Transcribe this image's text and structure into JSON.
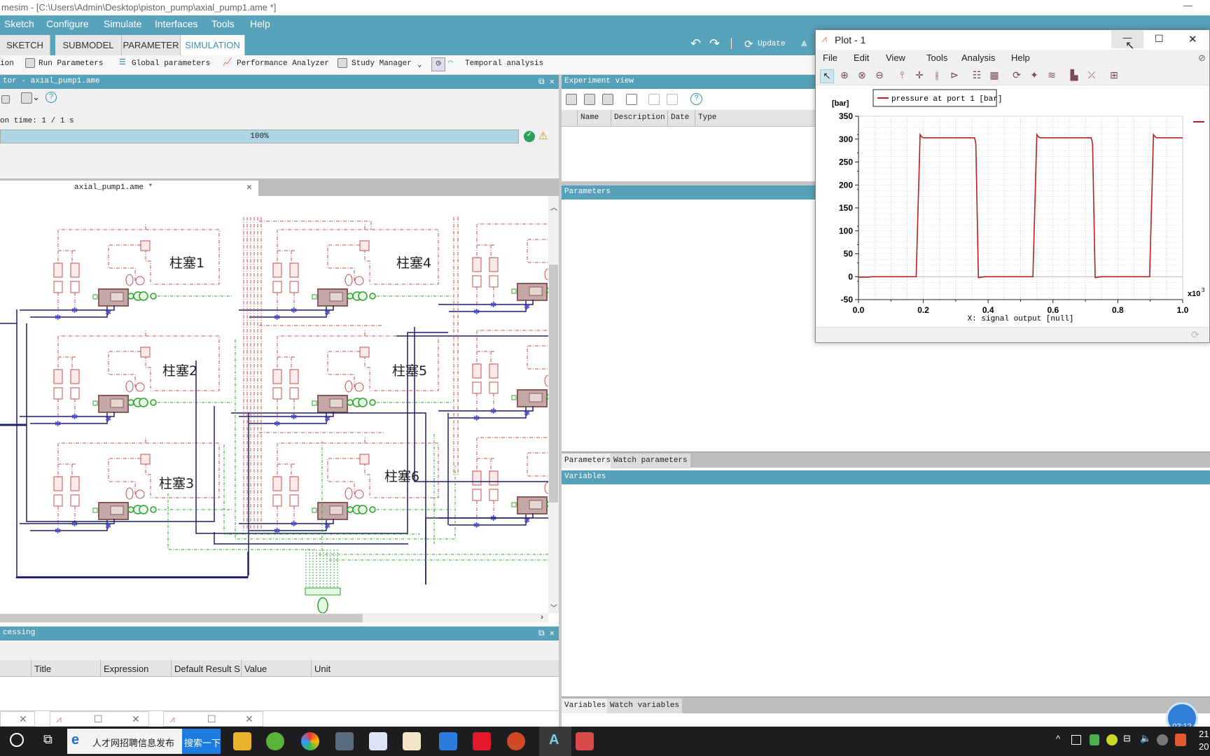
{
  "window": {
    "title": "mesim - [C:\\Users\\Admin\\Desktop\\piston_pump\\axial_pump1.ame *]",
    "minimize": "—"
  },
  "menu": [
    "Sketch",
    "Configure",
    "Simulate",
    "Interfaces",
    "Tools",
    "Help"
  ],
  "ribbon_tabs": [
    {
      "label": "SKETCH"
    },
    {
      "label": "SUBMODEL"
    },
    {
      "label": "PARAMETER"
    },
    {
      "label": "SIMULATION",
      "active": true
    }
  ],
  "ribbon_right": {
    "undo": "↶",
    "redo": "↷",
    "update": "Update"
  },
  "toolbar": {
    "run": "ion",
    "run_parameters": "Run Parameters",
    "global_parameters": "Global parameters",
    "performance_analyzer": "Performance Analyzer",
    "study_manager": "Study Manager",
    "temporal_analysis": "Temporal analysis"
  },
  "monitor": {
    "title": "tor - axial_pump1.ame",
    "time_text": "on time: 1 / 1 s",
    "progress_percent": 100,
    "progress_label": "100%",
    "status_color": "#2e9e5b"
  },
  "sketch": {
    "tab": "axial_pump1.ame *",
    "labels": [
      "柱塞1",
      "柱塞2",
      "柱塞3",
      "柱塞4",
      "柱塞5",
      "柱塞6"
    ],
    "colors": {
      "signal": "#c0504d",
      "hydraulic": "#1f1f6e",
      "mechanical": "#2ca02c"
    }
  },
  "post": {
    "title": "cessing",
    "columns": [
      "Title",
      "Expression",
      "Default Result S",
      "Value",
      "Unit"
    ]
  },
  "experiment": {
    "title": "Experiment view",
    "columns": [
      "Name",
      "Description",
      "Date",
      "Type"
    ]
  },
  "parameters": {
    "title": "Parameters",
    "tabs": [
      "Parameters",
      "Watch parameters"
    ]
  },
  "variables": {
    "title": "Variables",
    "tabs": [
      "Variables",
      "Watch variables"
    ]
  },
  "timer_badge": "02:12",
  "plot": {
    "title": "Plot - 1",
    "menu": [
      "File",
      "Edit",
      "View",
      "Tools",
      "Analysis",
      "Help"
    ],
    "toolbar_icons": [
      "select-arrow-icon",
      "zoom-region-icon",
      "zoom-in-icon",
      "zoom-out-icon",
      "cursor-icon",
      "crosshair-icon",
      "dual-cursor-icon",
      "play-cursor-icon",
      "table-icon",
      "grid-layout-icon",
      "refresh-icon",
      "pin-icon",
      "curves-icon",
      "histogram-icon",
      "xy-plot-icon",
      "add-plot-icon"
    ]
  },
  "chart_data": {
    "type": "line",
    "ylabel": "[bar]",
    "xlabel": "X: signal output [null]",
    "x_multiplier": "x10",
    "x_multiplier_exp": "3",
    "xlim": [
      0,
      1.0
    ],
    "ylim": [
      -50,
      350
    ],
    "xticks": [
      "0.0",
      "0.2",
      "0.4",
      "0.6",
      "0.8",
      "1.0"
    ],
    "yticks": [
      "350",
      "300",
      "250",
      "200",
      "150",
      "100",
      "50",
      "0",
      "-50"
    ],
    "grid": true,
    "legend_position": "top-left",
    "series": [
      {
        "name": "pressure at port 1 [bar]",
        "color": "#b22222",
        "x": [
          0,
          0.03,
          0.04,
          0.178,
          0.19,
          0.195,
          0.2,
          0.358,
          0.362,
          0.37,
          0.38,
          0.39,
          0.538,
          0.55,
          0.555,
          0.56,
          0.718,
          0.722,
          0.73,
          0.74,
          0.75,
          0.898,
          0.91,
          0.915,
          0.92,
          1.0
        ],
        "y": [
          -1,
          -1,
          0,
          0,
          310,
          305,
          303,
          303,
          290,
          -2,
          -1,
          0,
          0,
          310,
          305,
          303,
          303,
          290,
          -2,
          -1,
          0,
          0,
          310,
          305,
          303,
          303
        ]
      }
    ]
  },
  "taskbar": {
    "search_text": "人才网招聘信息发布",
    "search_button": "搜索一下",
    "clock_line1": "21",
    "clock_line2": "20"
  }
}
